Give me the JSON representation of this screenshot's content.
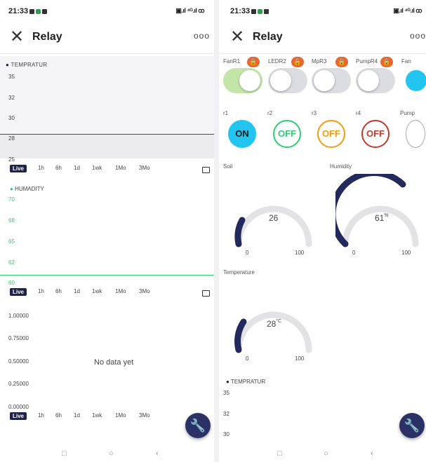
{
  "status": {
    "time": "21:33",
    "right_icons": "▣.ıl ⁴ᴳ.ıl ꝏ"
  },
  "nav": {
    "square": "□",
    "circle": "○",
    "back": "‹"
  },
  "left": {
    "title": "Relay",
    "more": "ooo",
    "chart1": {
      "label": "TEMPRATUR",
      "ticks": [
        "35",
        "32",
        "30",
        "28",
        "25"
      ]
    },
    "chart2": {
      "label": "HUMADITY",
      "ticks": [
        "70",
        "68",
        "65",
        "62",
        "60"
      ]
    },
    "chart3": {
      "ticks": [
        "1.00000",
        "0.75000",
        "0.50000",
        "0.25000",
        "0.00000"
      ],
      "empty_text": "No data yet"
    },
    "timeranges": [
      "Live",
      "1h",
      "6h",
      "1d",
      "1wk",
      "1Mo",
      "3Mo"
    ]
  },
  "right": {
    "title": "Relay",
    "more": "ooo",
    "switches": [
      {
        "label": "FanR1",
        "state": "on"
      },
      {
        "label": "LEDR2",
        "state": "off"
      },
      {
        "label": "MpR3",
        "state": "off"
      },
      {
        "label": "PumpR4",
        "state": "off"
      },
      {
        "label": "Fan",
        "state": "on"
      }
    ],
    "buttons": [
      {
        "label": "r1",
        "text": "ON"
      },
      {
        "label": "r2",
        "text": "OFF"
      },
      {
        "label": "r3",
        "text": "OFF"
      },
      {
        "label": "r4",
        "text": "OFF"
      },
      {
        "label": "Pump",
        "text": ""
      }
    ],
    "gauges": [
      {
        "label": "Soil",
        "value": "26",
        "min": "0",
        "max": "100"
      },
      {
        "label": "Humidity",
        "value": "61",
        "unit": "%",
        "min": "0",
        "max": "100"
      },
      {
        "label": "Temperature",
        "value": "28",
        "unit": "°C",
        "min": "0",
        "max": "100"
      }
    ],
    "chart": {
      "label": "TEMPRATUR",
      "ticks": [
        "35",
        "32",
        "30"
      ]
    }
  },
  "colors": {
    "accent": "#1f2348",
    "green": "#2ecc71",
    "orange": "#f39c12",
    "red": "#c0392b",
    "cyan": "#22c5f0",
    "gauge_track": "#e3e3e5",
    "gauge_fill": "#23295a"
  },
  "icons": [
    "close-icon",
    "more-icon",
    "lock-icon",
    "wrench-icon",
    "expand-icon"
  ]
}
